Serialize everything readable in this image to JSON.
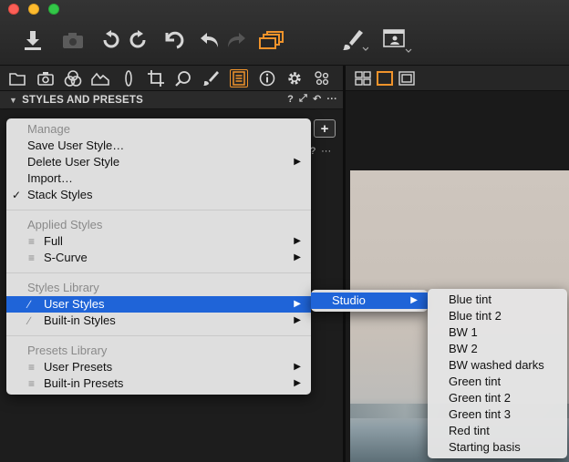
{
  "panel": {
    "title": "STYLES AND PRESETS",
    "help_glyph": "?",
    "more_glyph": "···",
    "add_glyph": "+"
  },
  "main_menu": {
    "sections": [
      {
        "header": "Manage",
        "items": [
          {
            "label": "Save User Style…",
            "checked": false,
            "submenu": false
          },
          {
            "label": "Delete User Style",
            "checked": false,
            "submenu": true
          },
          {
            "label": "Import…",
            "checked": false,
            "submenu": false
          },
          {
            "label": "Stack Styles",
            "checked": true,
            "submenu": false
          }
        ]
      },
      {
        "header": "Applied Styles",
        "items": [
          {
            "label": "Full",
            "submenu": true,
            "icon": "list-icon"
          },
          {
            "label": "S-Curve",
            "submenu": true,
            "icon": "list-icon"
          }
        ]
      },
      {
        "header": "Styles Library",
        "items": [
          {
            "label": "User Styles",
            "submenu": true,
            "icon": "brush-icon",
            "selected": true
          },
          {
            "label": "Built-in Styles",
            "submenu": true,
            "icon": "brush-icon"
          }
        ]
      },
      {
        "header": "Presets Library",
        "items": [
          {
            "label": "User Presets",
            "submenu": true,
            "icon": "list-icon"
          },
          {
            "label": "Built-in Presets",
            "submenu": true,
            "icon": "list-icon"
          }
        ]
      }
    ],
    "check_glyph": "✓",
    "arrow_glyph": "▶",
    "list_glyph": "≡",
    "brush_glyph": "∕"
  },
  "studio_menu": {
    "items": [
      {
        "label": "Studio",
        "submenu": true,
        "selected": true
      }
    ]
  },
  "presets_menu": {
    "items": [
      {
        "label": "Blue tint"
      },
      {
        "label": "Blue tint 2"
      },
      {
        "label": "BW 1"
      },
      {
        "label": "BW 2"
      },
      {
        "label": "BW washed darks"
      },
      {
        "label": "Green tint"
      },
      {
        "label": "Green tint 2"
      },
      {
        "label": "Green tint 3"
      },
      {
        "label": "Red tint"
      },
      {
        "label": "Starting basis"
      }
    ]
  },
  "colors": {
    "accent": "#f0932b",
    "selection": "#1f64d8",
    "toolbar_icon": "#d6d6d6"
  }
}
